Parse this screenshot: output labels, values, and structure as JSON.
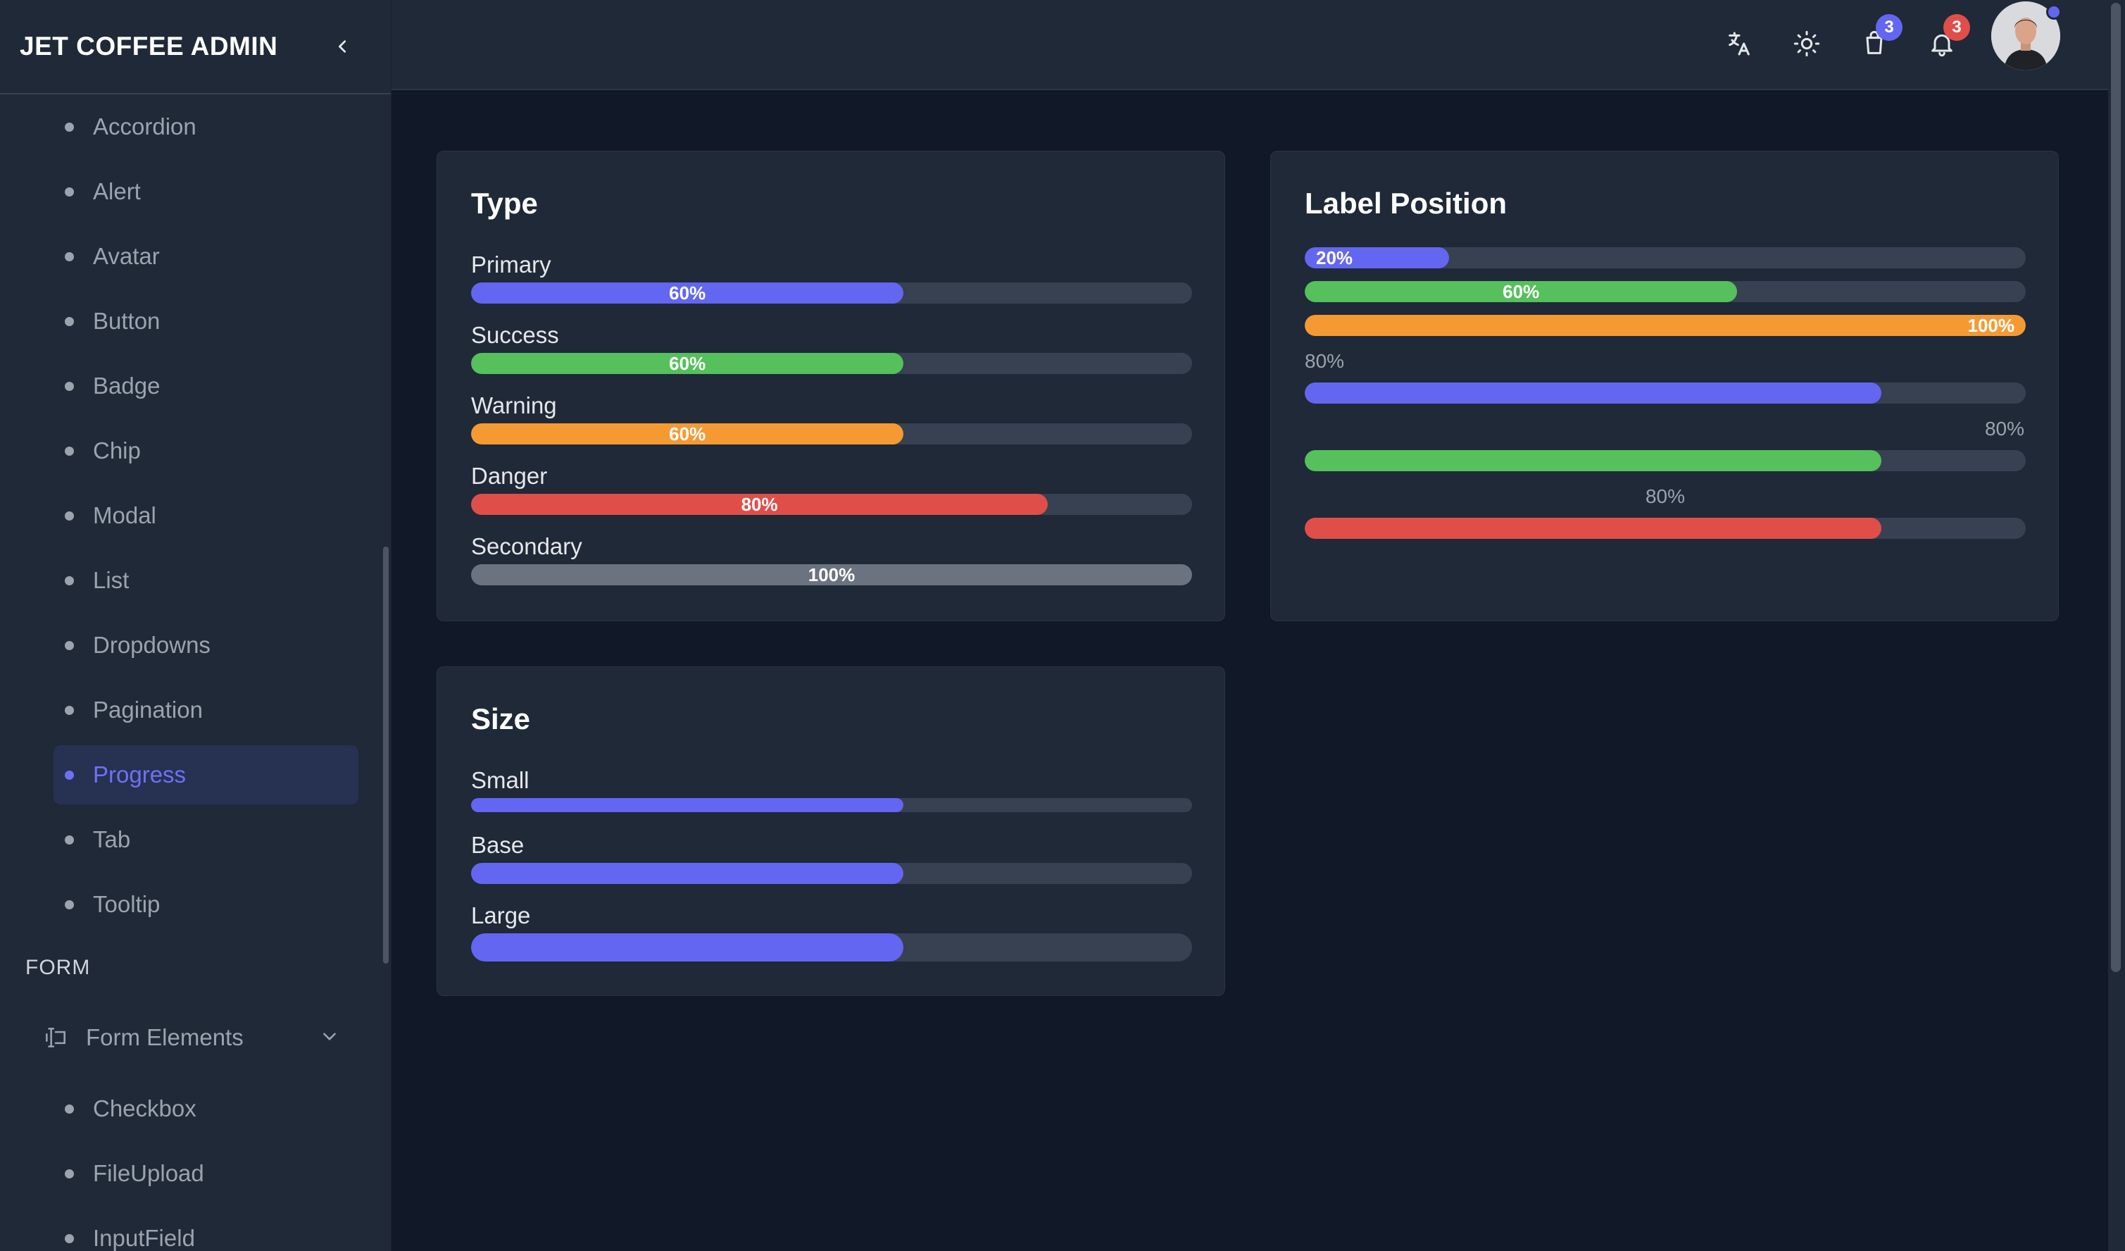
{
  "sidebar": {
    "brand": "JET COFFEE ADMIN",
    "items": [
      {
        "label": "Accordion",
        "active": false
      },
      {
        "label": "Alert",
        "active": false
      },
      {
        "label": "Avatar",
        "active": false
      },
      {
        "label": "Button",
        "active": false
      },
      {
        "label": "Badge",
        "active": false
      },
      {
        "label": "Chip",
        "active": false
      },
      {
        "label": "Modal",
        "active": false
      },
      {
        "label": "List",
        "active": false
      },
      {
        "label": "Dropdowns",
        "active": false
      },
      {
        "label": "Pagination",
        "active": false
      },
      {
        "label": "Progress",
        "active": true
      },
      {
        "label": "Tab",
        "active": false
      },
      {
        "label": "Tooltip",
        "active": false
      }
    ],
    "section_form": "FORM",
    "form_group": {
      "label": "Form Elements",
      "icon": "form-elements-icon"
    },
    "form_items": [
      {
        "label": "Checkbox"
      },
      {
        "label": "FileUpload"
      },
      {
        "label": "InputField"
      }
    ]
  },
  "topbar": {
    "icons": [
      "translate-icon",
      "sun-icon",
      "cart-icon",
      "bell-icon"
    ],
    "cart_badge": "3",
    "notification_badge": "3"
  },
  "colors": {
    "primary": "#6366f1",
    "success": "#55c05c",
    "warning": "#f59a33",
    "danger": "#e04e4a",
    "secondary": "#6b7280",
    "track": "#374151"
  },
  "type_card": {
    "title": "Type",
    "rows": [
      {
        "label": "Primary",
        "value": 60,
        "text": "60%",
        "color": "#6366f1"
      },
      {
        "label": "Success",
        "value": 60,
        "text": "60%",
        "color": "#55c05c"
      },
      {
        "label": "Warning",
        "value": 60,
        "text": "60%",
        "color": "#f59a33"
      },
      {
        "label": "Danger",
        "value": 80,
        "text": "80%",
        "color": "#e04e4a"
      },
      {
        "label": "Secondary",
        "value": 100,
        "text": "100%",
        "color": "#6b7280"
      }
    ]
  },
  "label_position_card": {
    "title": "Label Position",
    "inside_rows": [
      {
        "value": 20,
        "text": "20%",
        "align": "start",
        "color": "#6366f1"
      },
      {
        "value": 60,
        "text": "60%",
        "align": "center",
        "color": "#55c05c"
      },
      {
        "value": 100,
        "text": "100%",
        "align": "end",
        "color": "#f59a33"
      }
    ],
    "outside_rows": [
      {
        "value": 80,
        "text": "80%",
        "align": "left",
        "color": "#6366f1"
      },
      {
        "value": 80,
        "text": "80%",
        "align": "right",
        "color": "#55c05c"
      },
      {
        "value": 80,
        "text": "80%",
        "align": "center",
        "color": "#e04e4a"
      }
    ]
  },
  "size_card": {
    "title": "Size",
    "rows": [
      {
        "label": "Small",
        "value": 60,
        "color": "#6366f1"
      },
      {
        "label": "Base",
        "value": 60,
        "color": "#6366f1"
      },
      {
        "label": "Large",
        "value": 60,
        "color": "#6366f1"
      }
    ]
  }
}
